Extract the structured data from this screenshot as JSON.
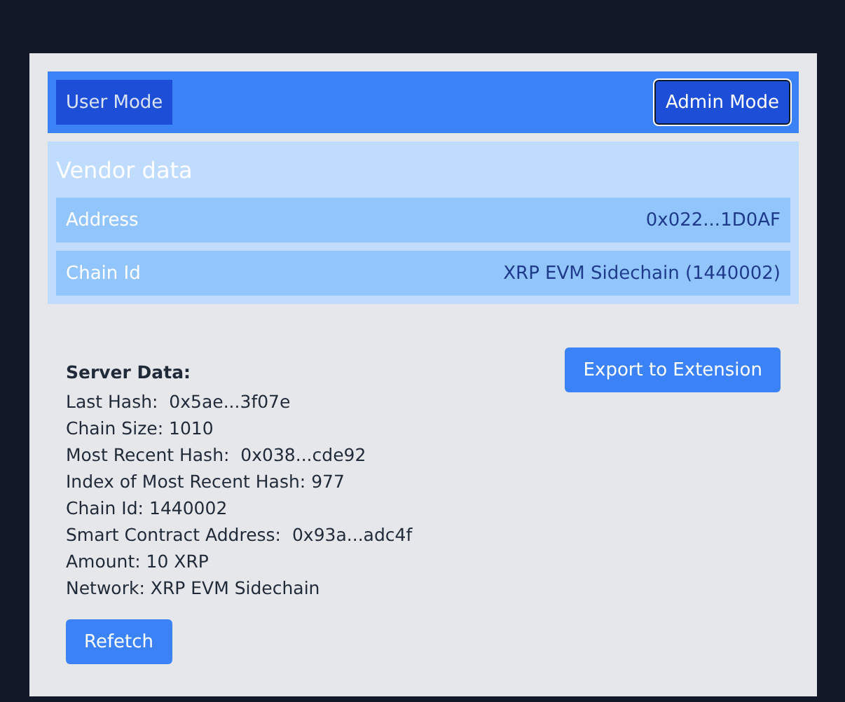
{
  "modes": [
    {
      "label": "User Mode",
      "selected": false
    },
    {
      "label": "Admin Mode",
      "selected": true
    }
  ],
  "vendor": {
    "title": "Vendor data",
    "rows": [
      {
        "label": "Address",
        "value": "0x022...1D0AF"
      },
      {
        "label": "Chain Id",
        "value": "XRP EVM Sidechain (1440002)"
      }
    ]
  },
  "server": {
    "title": "Server Data:",
    "lines": [
      "Last Hash:  0x5ae...3f07e",
      "Chain Size: 1010",
      "Most Recent Hash:  0x038...cde92",
      "Index of Most Recent Hash: 977",
      "Chain Id: 1440002",
      "Smart Contract Address:  0x93a...adc4f",
      "Amount: 10 XRP",
      "Network: XRP EVM Sidechain"
    ],
    "export_button": "Export to Extension",
    "refetch_button": "Refetch"
  }
}
